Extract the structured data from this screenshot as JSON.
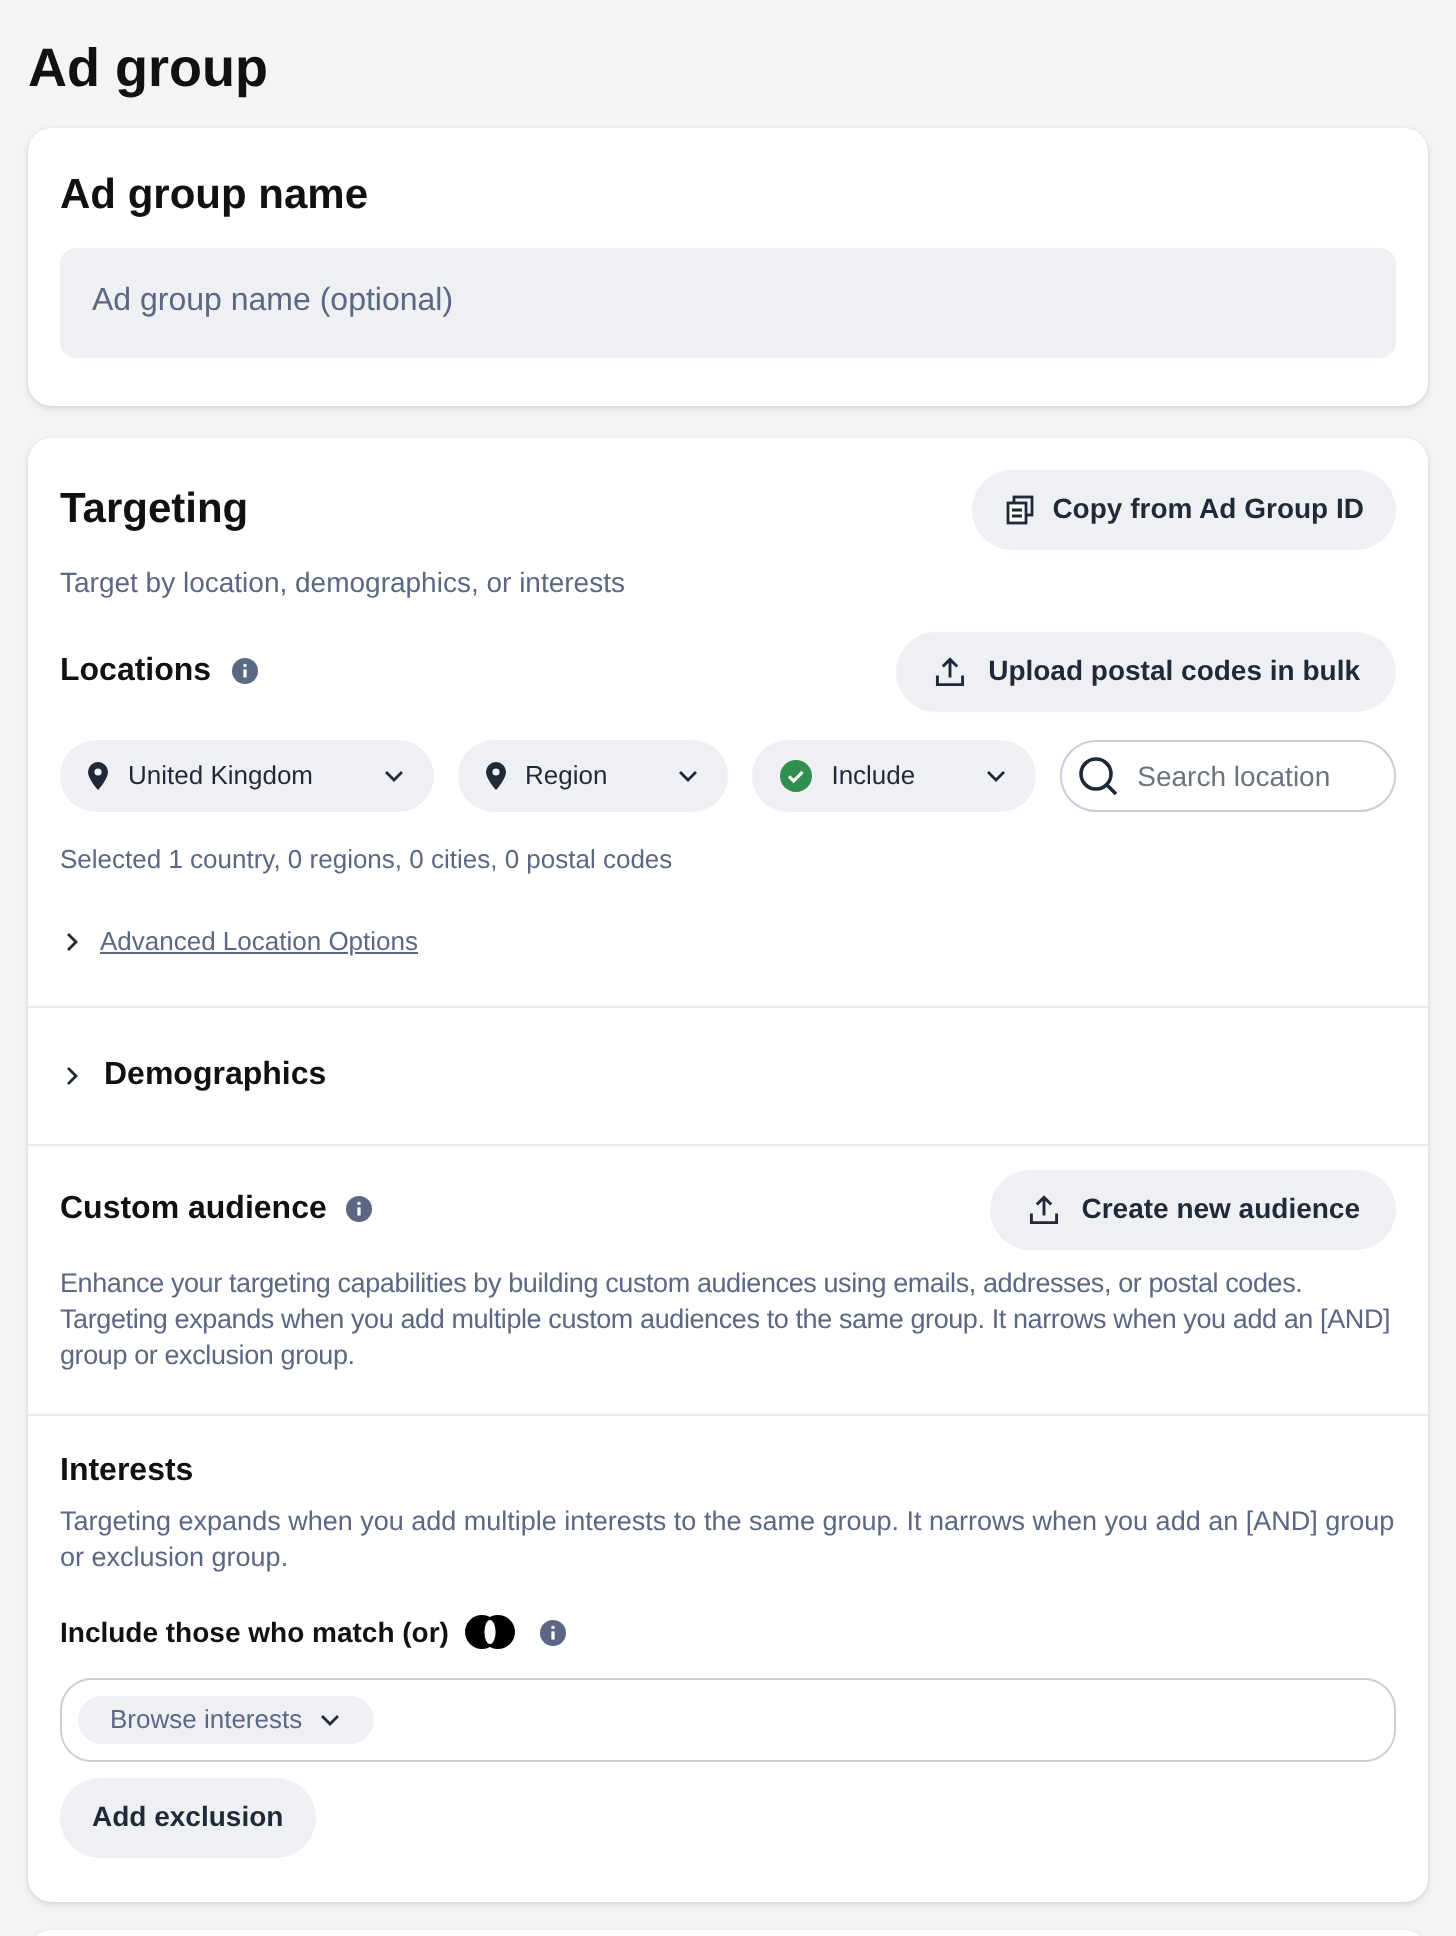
{
  "page_title": "Ad group",
  "name_card": {
    "title": "Ad group name",
    "placeholder": "Ad group name (optional)"
  },
  "targeting": {
    "title": "Targeting",
    "copy_button": "Copy from Ad Group ID",
    "subtitle": "Target by location, demographics, or interests",
    "locations": {
      "title": "Locations",
      "upload_button": "Upload postal codes in bulk",
      "filters": [
        {
          "kind": "pin",
          "label": "United Kingdom"
        },
        {
          "kind": "pin",
          "label": "Region"
        },
        {
          "kind": "check",
          "label": "Include"
        }
      ],
      "search": {
        "placeholder": "Search location"
      },
      "summary": "Selected 1 country, 0 regions, 0 cities, 0 postal codes",
      "advanced": {
        "label": "Advanced Location Options",
        "expanded": false
      }
    },
    "demographics": {
      "label": "Demographics",
      "expanded": false
    },
    "custom_audience": {
      "title": "Custom audience",
      "button": "Create new audience",
      "description": "Enhance your targeting capabilities by building custom audiences using emails, addresses, or postal codes. Targeting expands when you add multiple custom audiences to the same group. It narrows when you add an [AND] group or exclusion group."
    },
    "interests": {
      "title": "Interests",
      "description": "Targeting expands when you add multiple interests to the same group. It narrows when you add an [AND] group or exclusion group.",
      "match_label": "Include those who match (or)",
      "browse": "Browse interests",
      "exclusion_button": "Add exclusion"
    }
  }
}
